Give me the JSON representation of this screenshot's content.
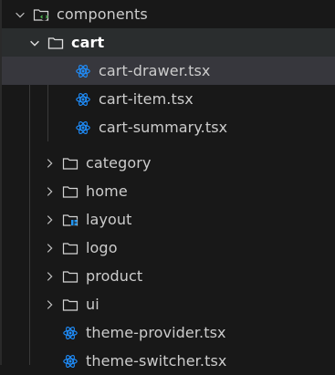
{
  "explorer": {
    "root_folder": {
      "label": "components",
      "icon": "components-folder-icon",
      "expanded": true
    },
    "cart_folder": {
      "label": "cart",
      "icon": "folder-icon",
      "expanded": true
    },
    "cart_files": [
      {
        "label": "cart-drawer.tsx",
        "icon": "react-icon"
      },
      {
        "label": "cart-item.tsx",
        "icon": "react-icon"
      },
      {
        "label": "cart-summary.tsx",
        "icon": "react-icon"
      }
    ],
    "folders": [
      {
        "label": "category",
        "icon": "folder-icon"
      },
      {
        "label": "home",
        "icon": "folder-icon"
      },
      {
        "label": "layout",
        "icon": "layout-folder-icon"
      },
      {
        "label": "logo",
        "icon": "folder-icon"
      },
      {
        "label": "product",
        "icon": "folder-icon"
      },
      {
        "label": "ui",
        "icon": "folder-icon"
      }
    ],
    "files": [
      {
        "label": "theme-provider.tsx",
        "icon": "react-icon"
      },
      {
        "label": "theme-switcher.tsx",
        "icon": "react-icon"
      }
    ]
  },
  "colors": {
    "background": "#181818",
    "text": "#cccccc",
    "react_icon": "#1f8fff",
    "folder_outline": "#d4d4d4",
    "layout_badge": "#2196f3",
    "components_badge": "#4caf50"
  }
}
